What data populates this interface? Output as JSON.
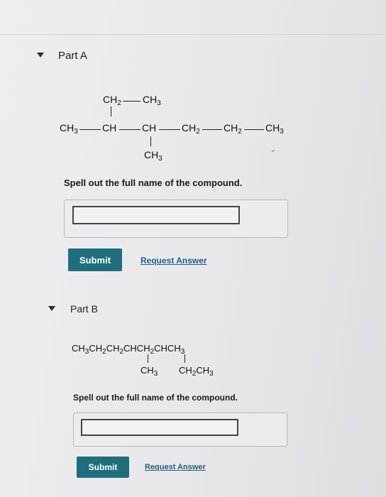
{
  "part_a": {
    "title": "Part A",
    "structure": {
      "top": [
        "CH2",
        "CH3"
      ],
      "main": [
        "CH3",
        "CH",
        "CH",
        "CH2",
        "CH2",
        "CH3"
      ],
      "bottom": "CH3"
    },
    "question": "Spell out the full name of the compound.",
    "answer_value": "",
    "submit_label": "Submit",
    "request_label": "Request Answer"
  },
  "part_b": {
    "title": "Part B",
    "formula": "CH3CH2CH2CHCH2CHCH3",
    "substituents": [
      "CH3",
      "CH2CH3"
    ],
    "question": "Spell out the full name of the compound.",
    "answer_value": "",
    "submit_label": "Submit",
    "request_label": "Request Answer"
  },
  "colors": {
    "submit_bg": "#1f6e7d",
    "link": "#1f5f86",
    "background": "#e9e9eb"
  }
}
